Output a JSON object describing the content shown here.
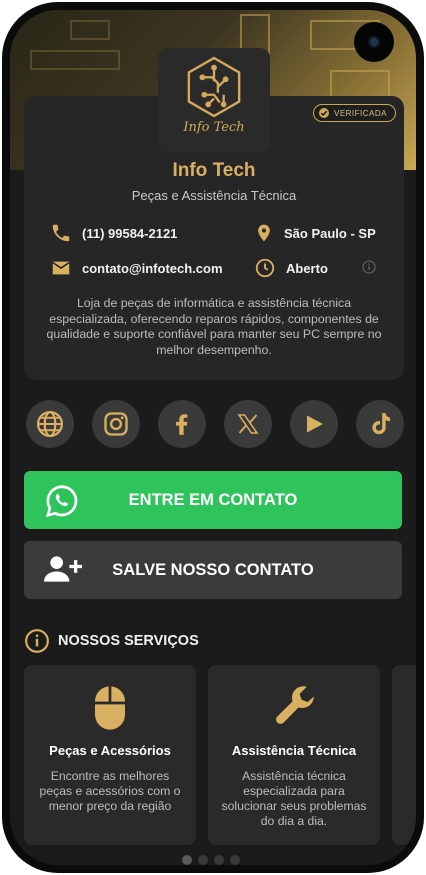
{
  "profile": {
    "logo_text": "Info Tech",
    "badge": "VERIFICADA",
    "name": "Info Tech",
    "tagline": "Peças e Assistência Técnica",
    "phone": "(11) 99584-2121",
    "location": "São Paulo - SP",
    "email": "contato@infotech.com",
    "status": "Aberto",
    "description": "Loja de peças de informática e assistência técnica especializada, oferecendo reparos rápidos, componentes de qualidade e suporte confiável para manter seu PC sempre no melhor desempenho."
  },
  "socials": [
    "globe-icon",
    "instagram-icon",
    "facebook-icon",
    "x-icon",
    "youtube-icon",
    "tiktok-icon"
  ],
  "actions": {
    "contact_label": "ENTRE EM CONTATO",
    "save_label": "SALVE NOSSO CONTATO"
  },
  "services": {
    "heading": "NOSSOS SERVIÇOS",
    "items": [
      {
        "name": "Peças e Acessórios",
        "text": "Encontre as melhores peças e acessórios com o menor preço da região"
      },
      {
        "name": "Assistência Técnica",
        "text": "Assistência técnica especializada para solucionar seus problemas do dia a dia."
      }
    ]
  },
  "colors": {
    "accent": "#d9b061",
    "whatsapp": "#2ec45b",
    "card": "#262626",
    "background": "#1b1b1b"
  }
}
